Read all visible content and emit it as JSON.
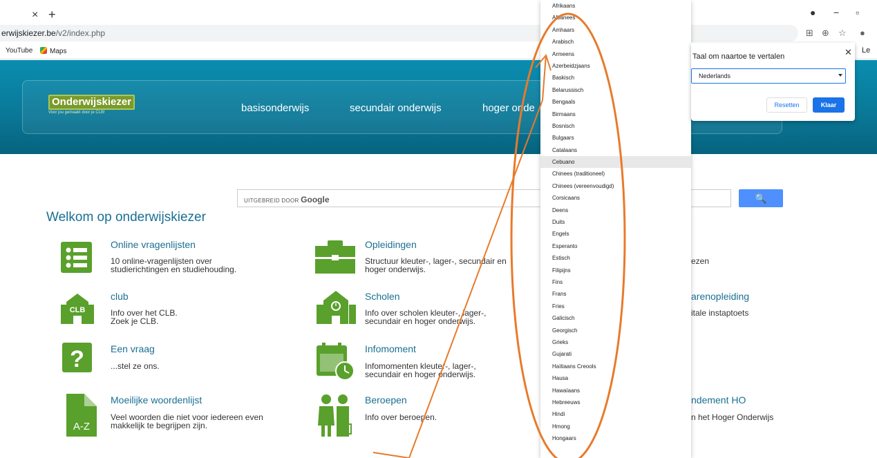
{
  "browser": {
    "tab_close": "×",
    "tab_new": "+",
    "url_host": "erwijskiezer.be",
    "url_path": "/v2/index.php",
    "bookmarks": [
      "YouTube",
      "Maps"
    ],
    "side_panel_label": "Le"
  },
  "site": {
    "logo_text": "Onderwijskiezer",
    "logo_sub": "Voor jou gemaakt door je CLB!",
    "nav": [
      "basisonderwijs",
      "secundair onderwijs",
      "hoger onde"
    ],
    "search_label_prefix": "UITGEBREID DOOR",
    "search_label_brand": "Google",
    "search_button": "🔍",
    "welcome": "Welkom op onderwijskiezer",
    "tiles": [
      {
        "title": "Online vragenlijsten",
        "desc1": "10 online-vragenlijsten over",
        "desc2": "studierichtingen en studiehouding."
      },
      {
        "title": "Opleidingen",
        "desc1": "Structuur kleuter-, lager-, secundair en",
        "desc2": "hoger onderwijs."
      },
      {
        "title": "club",
        "desc1": "Info over het CLB.",
        "desc2": "Zoek je CLB."
      },
      {
        "title": "Scholen",
        "desc1": "Info over scholen kleuter-, lager-,",
        "desc2": "secundair en hoger onderwijs."
      },
      {
        "title": "Een vraag",
        "desc1": "...stel ze ons.",
        "desc2": ""
      },
      {
        "title": "Infomoment",
        "desc1": "Infomomenten kleuter-, lager-,",
        "desc2": "secundair en hoger onderwijs."
      },
      {
        "title": "Moeilijke woordenlijst",
        "desc1": "Veel woorden die niet voor iedereen even",
        "desc2": "makkelijk te begrijpen zijn."
      },
      {
        "title": "Beroepen",
        "desc1": "Info over beroepen.",
        "desc2": ""
      }
    ],
    "right_fragments": [
      "ezen",
      "arenopleiding",
      "itale instaptoets",
      "ndement HO",
      "n het Hoger Onderwijs"
    ],
    "clb_icon_text": "CLB",
    "az_icon_text": "A-Z"
  },
  "translate": {
    "title": "Taal om naartoe te vertalen",
    "selected": "Nederlands",
    "reset": "Resetten",
    "done": "Klaar",
    "highlighted_index": 13,
    "languages": [
      "Afrikaans",
      "Albanees",
      "Amhaars",
      "Arabisch",
      "Armeens",
      "Azerbeidzjaans",
      "Baskisch",
      "Belarussisch",
      "Bengaals",
      "Birmaans",
      "Bosnisch",
      "Bulgaars",
      "Catalaans",
      "Cebuano",
      "Chinees (traditioneel)",
      "Chinees (vereenvoudigd)",
      "Corsicaans",
      "Deens",
      "Duits",
      "Engels",
      "Esperanto",
      "Estisch",
      "Filipijns",
      "Fins",
      "Frans",
      "Fries",
      "Galicisch",
      "Georgisch",
      "Grieks",
      "Gujarati",
      "Haïtiaans Creools",
      "Hausa",
      "Hawaïaans",
      "Hebreeuws",
      "Hindi",
      "Hmong",
      "Hongaars"
    ]
  },
  "colors": {
    "annotation": "#e87a2a",
    "site_teal": "#0a7796",
    "icon_green": "#5aa02c",
    "link_blue": "#1a6f93"
  }
}
